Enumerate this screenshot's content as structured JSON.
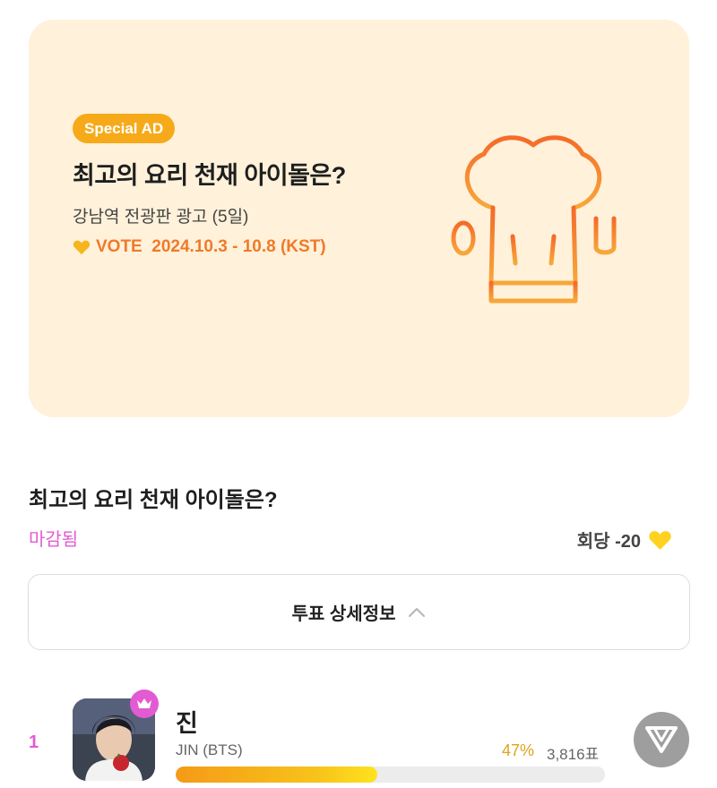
{
  "banner": {
    "badge": "Special AD",
    "title": "최고의 요리 천재 아이돌은?",
    "subtitle": "강남역 전광판 광고 (5일)",
    "vote_period": "VOTE  2024.10.3 - 10.8 (KST)",
    "icons": [
      "heart-icon",
      "chef-hat-icon",
      "spoon-icon",
      "fork-icon"
    ]
  },
  "vote": {
    "title": "최고의 요리 천재 아이돌은?",
    "status": "마감됨",
    "cost_label": "회당 -20",
    "detail_button": "투표 상세정보"
  },
  "ranking": [
    {
      "rank": "1",
      "name": "진",
      "sub": "JIN (BTS)",
      "percent_label": "47%",
      "percent": 47,
      "votes": "3,816표"
    }
  ],
  "colors": {
    "accent_pink": "#e35bd2",
    "accent_orange": "#f07a28",
    "badge_yellow": "#f6aa1a",
    "heart_yellow": "#ffd21f",
    "banner_bg": "#fff1da"
  }
}
